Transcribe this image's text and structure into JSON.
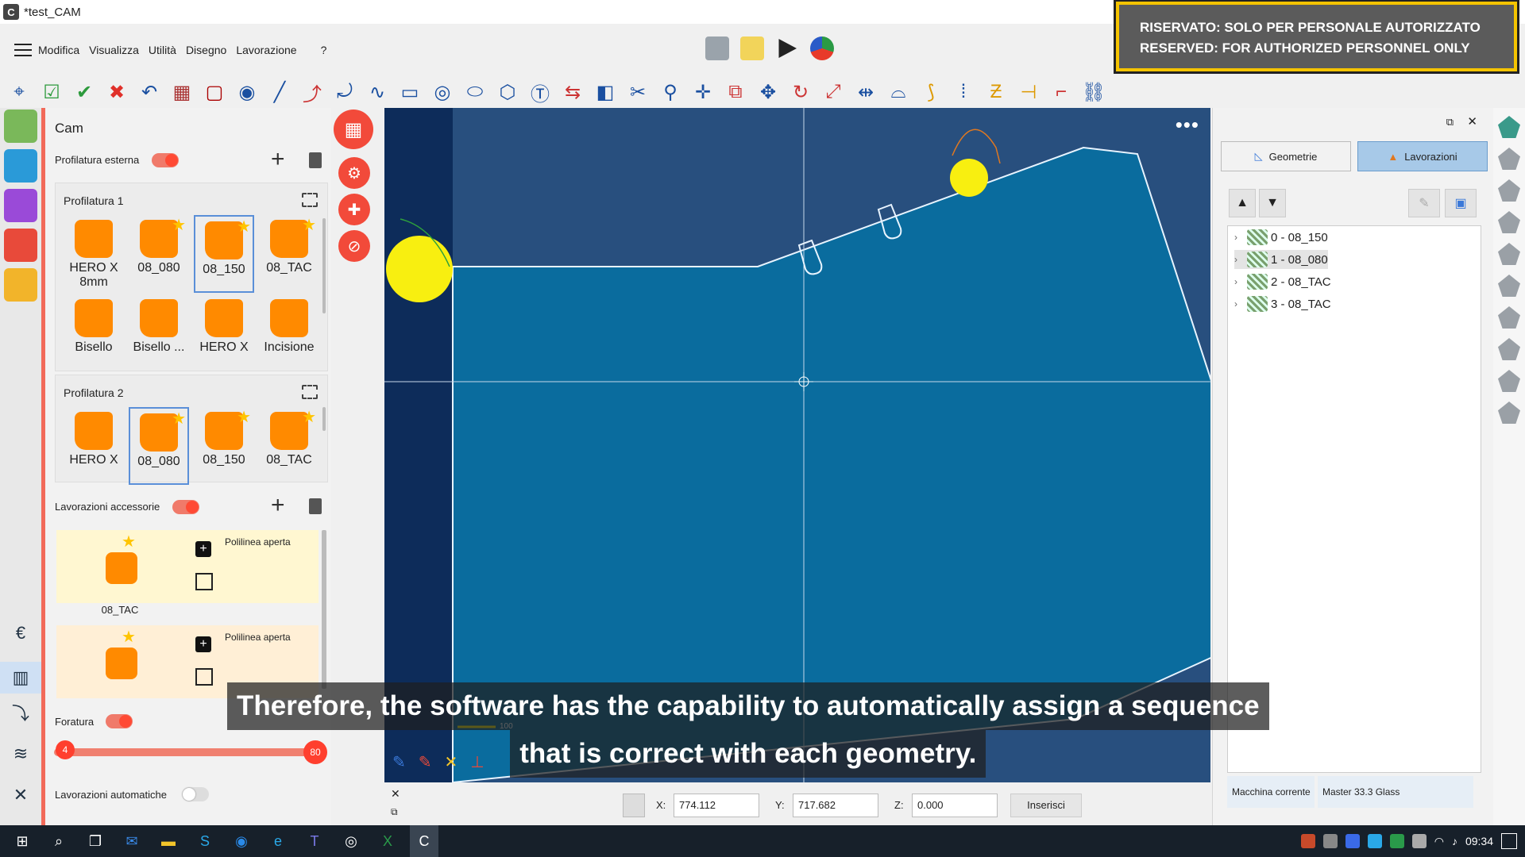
{
  "window": {
    "title": "*test_CAM",
    "app_letter": "C",
    "banner_line1": "RISERVATO: SOLO PER PERSONALE AUTORIZZATO",
    "banner_line2": "RESERVED: FOR AUTHORIZED PERSONNEL ONLY"
  },
  "menu": {
    "items": [
      "Modifica",
      "Visualizza",
      "Utilità",
      "Disegno",
      "Lavorazione",
      "?"
    ]
  },
  "cam": {
    "title": "Cam",
    "external_profile": {
      "label": "Profilatura esterna",
      "on": true
    },
    "group1": {
      "title": "Profilatura 1",
      "tools": [
        {
          "label": "HERO X 8mm",
          "star": false,
          "selected": false
        },
        {
          "label": "08_080",
          "star": true,
          "selected": false
        },
        {
          "label": "08_150",
          "star": true,
          "selected": true
        },
        {
          "label": "08_TAC",
          "star": true,
          "selected": false
        },
        {
          "label": "Bisello",
          "star": false,
          "selected": false
        },
        {
          "label": "Bisello ...",
          "star": false,
          "selected": false
        },
        {
          "label": "HERO X",
          "star": false,
          "selected": false
        },
        {
          "label": "Incisione",
          "star": false,
          "selected": false
        }
      ]
    },
    "group2": {
      "title": "Profilatura 2",
      "tools": [
        {
          "label": "HERO X",
          "star": false,
          "selected": false
        },
        {
          "label": "08_080",
          "star": true,
          "selected": true
        },
        {
          "label": "08_150",
          "star": true,
          "selected": false
        },
        {
          "label": "08_TAC",
          "star": true,
          "selected": false
        }
      ]
    },
    "accessory": {
      "label": "Lavorazioni accessorie",
      "on": true,
      "cards": [
        {
          "tool": "08_TAC",
          "operation": "Polilinea aperta"
        },
        {
          "tool": "",
          "operation": "Polilinea aperta"
        }
      ]
    },
    "drilling": {
      "label": "Foratura",
      "on": true,
      "min": "4",
      "max": "80"
    },
    "auto": {
      "label": "Lavorazioni automatiche",
      "on": false
    }
  },
  "canvas": {
    "dots": "•••",
    "scale_label": "100",
    "subtitle_line1": "Therefore, the software has the capability to automatically assign a sequence",
    "subtitle_line2": "that is correct with each geometry."
  },
  "coords": {
    "x_label": "X:",
    "x_value": "774.112",
    "y_label": "Y:",
    "y_value": "717.682",
    "z_label": "Z:",
    "z_value": "0.000",
    "insert_label": "Inserisci"
  },
  "right_panel": {
    "tabs": [
      {
        "label": "Geometrie",
        "active": false
      },
      {
        "label": "Lavorazioni",
        "active": true
      }
    ],
    "tree": [
      {
        "label": "0 - 08_150",
        "selected": false
      },
      {
        "label": "1 - 08_080",
        "selected": true
      },
      {
        "label": "2 - 08_TAC",
        "selected": false
      },
      {
        "label": "3 - 08_TAC",
        "selected": false
      }
    ],
    "machine_label": "Macchina corrente",
    "machine_value": "Master 33.3 Glass"
  },
  "taskbar": {
    "time": "09:34"
  },
  "colors": {
    "accent_red": "#f24a3a",
    "tool_orange": "#ff8a00",
    "canvas_bg": "#284f7e",
    "part_fill": "#0a6c9e"
  }
}
